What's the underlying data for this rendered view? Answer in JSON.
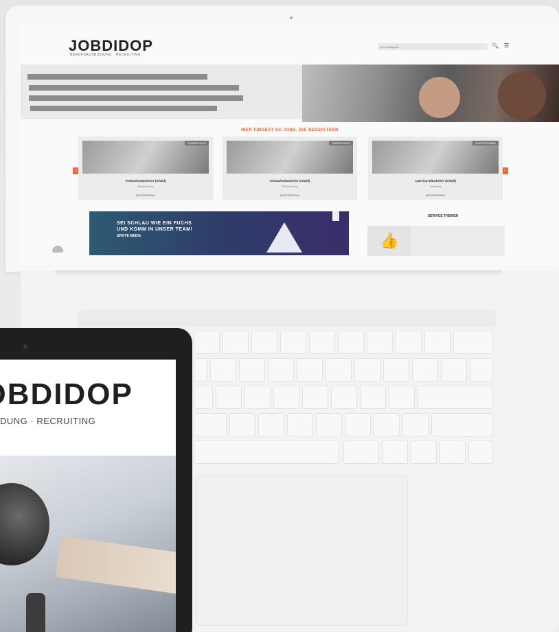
{
  "laptop_site": {
    "logo": "JOBDIDOP",
    "tagline": "BERUFSAUSBILDUNG · RECRUITING",
    "search_placeholder": "Alle Kategorien",
    "section_title": "HIER FINDEST DU JOBS, DIE BEGEISTERN",
    "job_cards": [
      {
        "badge": "FAHRSCHULE",
        "title": "Verkaufsmitarbeiter (m/w/d)",
        "location": "Mecklenburg",
        "company": "MUSTERFIRMA"
      },
      {
        "badge": "FAHRSCHULE",
        "title": "Verkaufsmitarbeiter (m/w/d)",
        "location": "Mecklenburg",
        "company": "MUSTERFIRMA"
      },
      {
        "badge": "GASTRONOMIE",
        "title": "Catering-Mitarbeiter (m/w/d)",
        "location": "Hamburg",
        "company": "MUSTERFIRMA"
      }
    ],
    "ad": {
      "line1": "SEI SCHLAU WIE EIN FUCHS",
      "line2": "UND KOMM IN UNSER TEAM!",
      "line3": "GROTE MEDIA"
    },
    "service": {
      "title": "SERVICE THEMEN",
      "items": []
    },
    "accent_color": "#e6673a"
  },
  "tablet_site": {
    "logo": "JOBDIDOP",
    "tagline": "DUNG · RECRUITING"
  }
}
